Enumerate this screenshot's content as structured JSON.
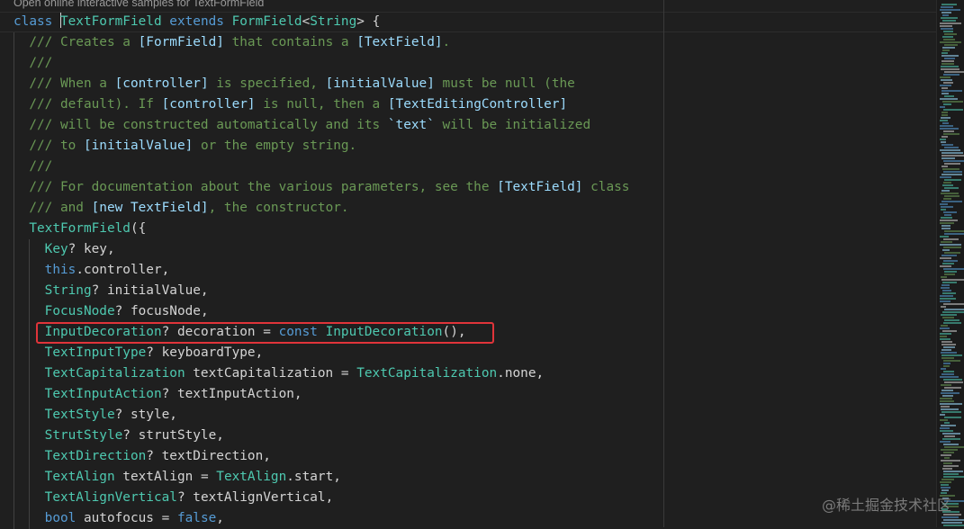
{
  "codelens": "Open online interactive samples for TextFormField",
  "watermark": "@稀土掘金技术社区",
  "highlight_color": "#e0343a",
  "lines": [
    {
      "indent": 0,
      "tokens": [
        [
          "kw",
          "class "
        ],
        [
          "ty",
          "TextFormField"
        ],
        [
          "kw",
          " extends "
        ],
        [
          "ty",
          "FormField"
        ],
        [
          "pl",
          "<"
        ],
        [
          "ty",
          "String"
        ],
        [
          "pl",
          "> {"
        ]
      ]
    },
    {
      "indent": 1,
      "tokens": [
        [
          "cm",
          "/// Creates a "
        ],
        [
          "cmref",
          "[FormField]"
        ],
        [
          "cm",
          " that contains a "
        ],
        [
          "cmref",
          "[TextField]"
        ],
        [
          "cm",
          "."
        ]
      ]
    },
    {
      "indent": 1,
      "tokens": [
        [
          "cm",
          "///"
        ]
      ]
    },
    {
      "indent": 1,
      "tokens": [
        [
          "cm",
          "/// When a "
        ],
        [
          "cmref",
          "[controller]"
        ],
        [
          "cm",
          " is specified, "
        ],
        [
          "cmref",
          "[initialValue]"
        ],
        [
          "cm",
          " must be null (the"
        ]
      ]
    },
    {
      "indent": 1,
      "tokens": [
        [
          "cm",
          "/// default). If "
        ],
        [
          "cmref",
          "[controller]"
        ],
        [
          "cm",
          " is null, then a "
        ],
        [
          "cmref",
          "[TextEditingController]"
        ]
      ]
    },
    {
      "indent": 1,
      "tokens": [
        [
          "cm",
          "/// will be constructed automatically and its "
        ],
        [
          "cmref",
          "`text`"
        ],
        [
          "cm",
          " will be initialized"
        ]
      ]
    },
    {
      "indent": 1,
      "tokens": [
        [
          "cm",
          "/// to "
        ],
        [
          "cmref",
          "[initialValue]"
        ],
        [
          "cm",
          " or the empty string."
        ]
      ]
    },
    {
      "indent": 1,
      "tokens": [
        [
          "cm",
          "///"
        ]
      ]
    },
    {
      "indent": 1,
      "tokens": [
        [
          "cm",
          "/// For documentation about the various parameters, see the "
        ],
        [
          "cmref",
          "[TextField]"
        ],
        [
          "cm",
          " class"
        ]
      ]
    },
    {
      "indent": 1,
      "tokens": [
        [
          "cm",
          "/// and "
        ],
        [
          "cmref",
          "[new TextField]"
        ],
        [
          "cm",
          ", the constructor."
        ]
      ]
    },
    {
      "indent": 1,
      "tokens": [
        [
          "ty",
          "TextFormField"
        ],
        [
          "pl",
          "({"
        ]
      ]
    },
    {
      "indent": 2,
      "tokens": [
        [
          "ty",
          "Key"
        ],
        [
          "pl",
          "? key,"
        ]
      ]
    },
    {
      "indent": 2,
      "tokens": [
        [
          "kw",
          "this"
        ],
        [
          "pl",
          ".controller,"
        ]
      ]
    },
    {
      "indent": 2,
      "tokens": [
        [
          "ty",
          "String"
        ],
        [
          "pl",
          "? initialValue,"
        ]
      ]
    },
    {
      "indent": 2,
      "tokens": [
        [
          "ty",
          "FocusNode"
        ],
        [
          "pl",
          "? focusNode,"
        ]
      ]
    },
    {
      "indent": 2,
      "tokens": [
        [
          "ty",
          "InputDecoration"
        ],
        [
          "pl",
          "? decoration = "
        ],
        [
          "kw",
          "const "
        ],
        [
          "ty",
          "InputDecoration"
        ],
        [
          "pl",
          "(),"
        ]
      ]
    },
    {
      "indent": 2,
      "tokens": [
        [
          "ty",
          "TextInputType"
        ],
        [
          "pl",
          "? keyboardType,"
        ]
      ]
    },
    {
      "indent": 2,
      "tokens": [
        [
          "ty",
          "TextCapitalization"
        ],
        [
          "pl",
          " textCapitalization = "
        ],
        [
          "ty",
          "TextCapitalization"
        ],
        [
          "pl",
          ".none,"
        ]
      ]
    },
    {
      "indent": 2,
      "tokens": [
        [
          "ty",
          "TextInputAction"
        ],
        [
          "pl",
          "? textInputAction,"
        ]
      ]
    },
    {
      "indent": 2,
      "tokens": [
        [
          "ty",
          "TextStyle"
        ],
        [
          "pl",
          "? style,"
        ]
      ]
    },
    {
      "indent": 2,
      "tokens": [
        [
          "ty",
          "StrutStyle"
        ],
        [
          "pl",
          "? strutStyle,"
        ]
      ]
    },
    {
      "indent": 2,
      "tokens": [
        [
          "ty",
          "TextDirection"
        ],
        [
          "pl",
          "? textDirection,"
        ]
      ]
    },
    {
      "indent": 2,
      "tokens": [
        [
          "ty",
          "TextAlign"
        ],
        [
          "pl",
          " textAlign = "
        ],
        [
          "ty",
          "TextAlign"
        ],
        [
          "pl",
          ".start,"
        ]
      ]
    },
    {
      "indent": 2,
      "tokens": [
        [
          "ty",
          "TextAlignVertical"
        ],
        [
          "pl",
          "? textAlignVertical,"
        ]
      ]
    },
    {
      "indent": 2,
      "tokens": [
        [
          "kw",
          "bool"
        ],
        [
          "pl",
          " autofocus = "
        ],
        [
          "kw",
          "false"
        ],
        [
          "pl",
          ","
        ]
      ]
    }
  ]
}
